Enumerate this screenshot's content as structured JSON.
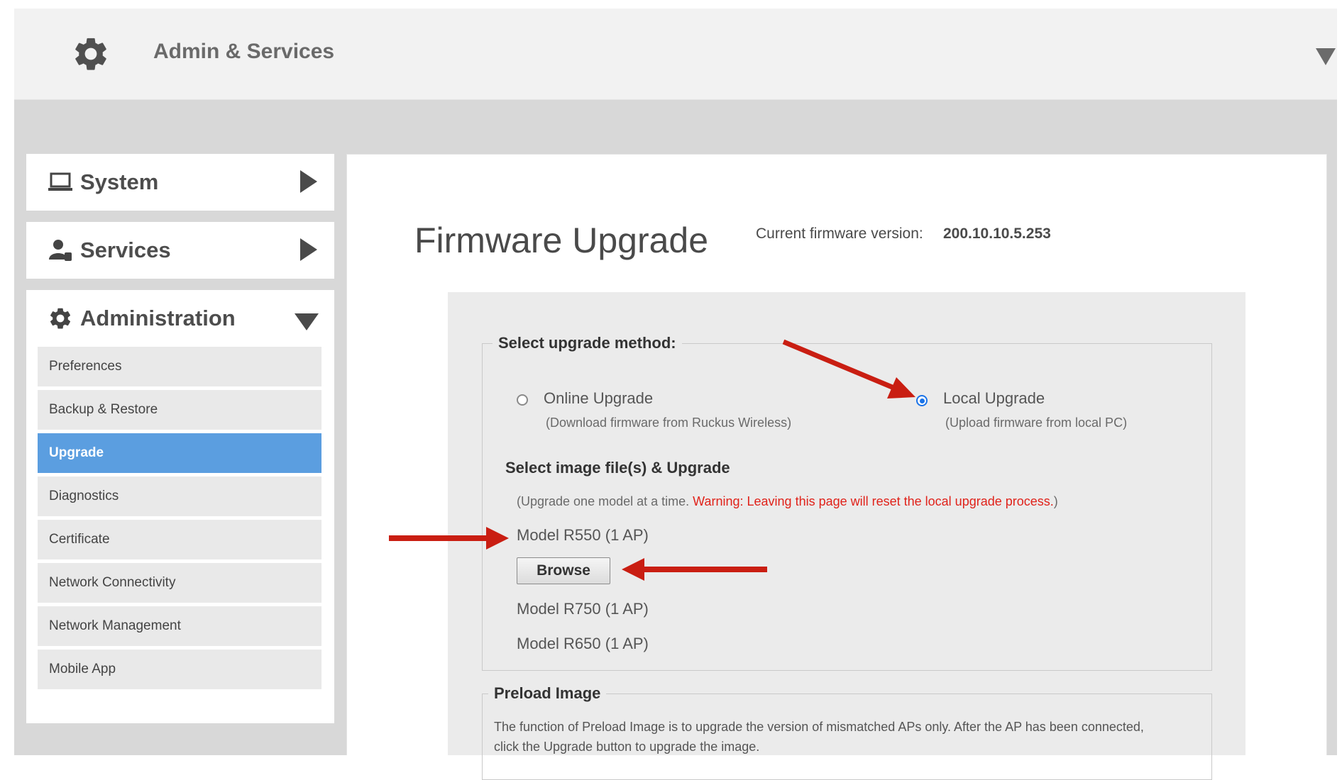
{
  "header": {
    "title": "Admin & Services",
    "icon": "gear-icon"
  },
  "sidebar": {
    "system": {
      "label": "System",
      "icon": "laptop-icon"
    },
    "services": {
      "label": "Services",
      "icon": "services-icon"
    },
    "administration": {
      "label": "Administration",
      "icon": "gear-icon",
      "items": [
        {
          "label": "Preferences"
        },
        {
          "label": "Backup & Restore"
        },
        {
          "label": "Upgrade",
          "active": true
        },
        {
          "label": "Diagnostics"
        },
        {
          "label": "Certificate"
        },
        {
          "label": "Network Connectivity"
        },
        {
          "label": "Network Management"
        },
        {
          "label": "Mobile App"
        }
      ]
    }
  },
  "main": {
    "title": "Firmware Upgrade",
    "firmware_label": "Current firmware version:",
    "firmware_value": "200.10.10.5.253",
    "upgrade_method": {
      "legend": "Select upgrade method:",
      "online": {
        "label": "Online Upgrade",
        "desc": "(Download firmware from Ruckus Wireless)",
        "selected": false
      },
      "local": {
        "label": "Local Upgrade",
        "desc": "(Upload firmware from local PC)",
        "selected": true
      }
    },
    "image_section": {
      "heading": "Select image file(s) & Upgrade",
      "note_prefix": "(Upgrade one model at a time.",
      "warning": "Warning: Leaving this page will reset the local upgrade process.",
      "note_suffix": ")",
      "models": [
        "Model R550 (1 AP)",
        "Model R750 (1 AP)",
        "Model R650 (1 AP)"
      ],
      "browse_label": "Browse"
    },
    "preload": {
      "legend": "Preload Image",
      "line1": "The function of Preload Image is to upgrade the version of mismatched APs only. After the AP has been connected,",
      "line2": "click the Upgrade button to upgrade the image."
    }
  },
  "colors": {
    "accent": "#5b9ee0",
    "warning": "#e0221a",
    "annotation_arrow": "#c91e12"
  }
}
